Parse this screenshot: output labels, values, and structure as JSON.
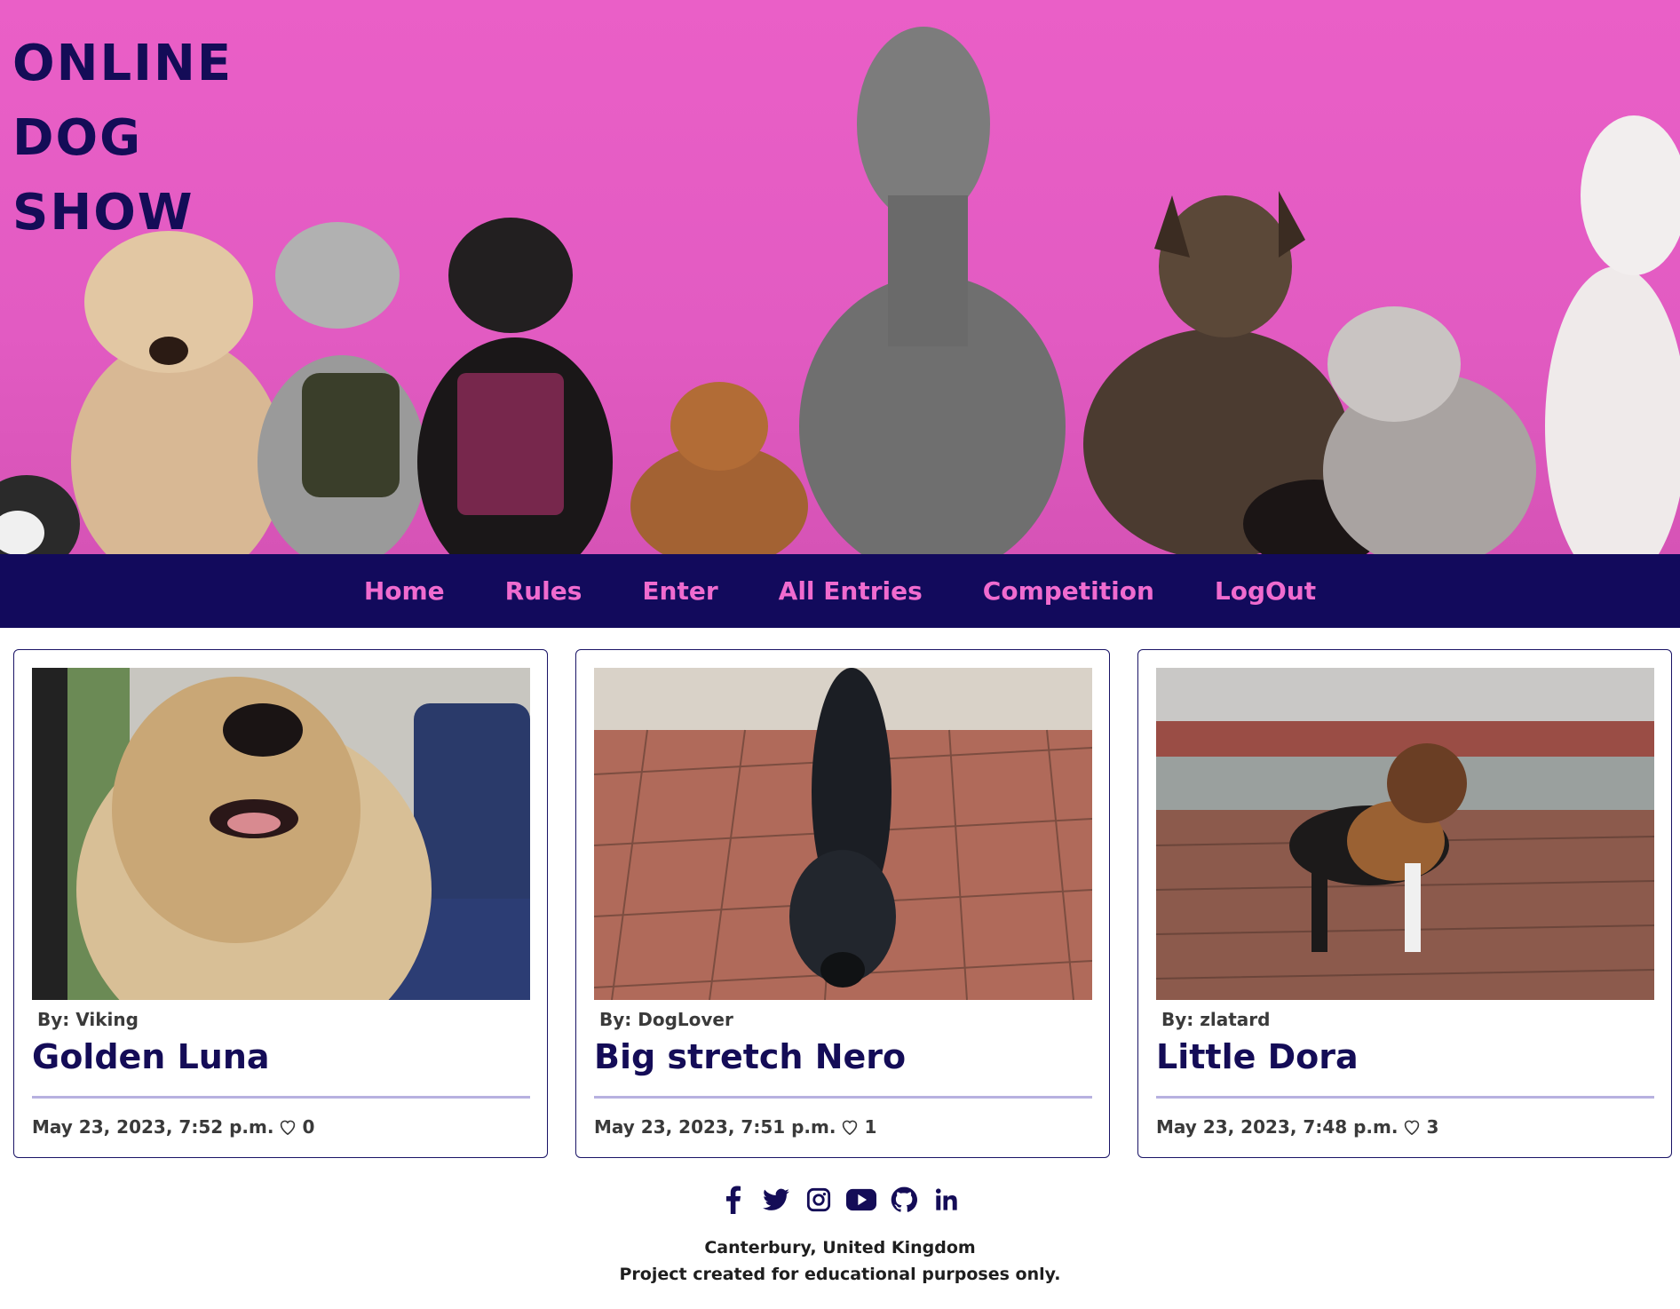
{
  "header": {
    "title_lines": [
      "ONLINE",
      "DOG",
      "SHOW"
    ]
  },
  "nav": {
    "items": [
      {
        "label": "Home"
      },
      {
        "label": "Rules"
      },
      {
        "label": "Enter"
      },
      {
        "label": "All Entries"
      },
      {
        "label": "Competition"
      },
      {
        "label": "LogOut"
      }
    ]
  },
  "cards": [
    {
      "author": "By: Viking",
      "title": "Golden Luna",
      "date": "May 23, 2023, 7:52 p.m.",
      "likes": "0",
      "image": "golden-retriever-in-car"
    },
    {
      "author": "By: DogLover",
      "title": "Big stretch Nero",
      "date": "May 23, 2023, 7:51 p.m.",
      "likes": "1",
      "image": "black-dog-stretching-on-tiles"
    },
    {
      "author": "By: zlatard",
      "title": "Little Dora",
      "date": "May 23, 2023, 7:48 p.m.",
      "likes": "3",
      "image": "puppy-in-sweater"
    }
  ],
  "footer": {
    "social_icons": [
      "facebook-icon",
      "twitter-icon",
      "instagram-icon",
      "youtube-icon",
      "github-icon",
      "linkedin-icon"
    ],
    "location": "Canterbury, United Kingdom",
    "note": "Project created for educational purposes only."
  },
  "colors": {
    "navy": "#120a5c",
    "pink": "#f06bcf",
    "hero_bg": "#e25bc2"
  }
}
